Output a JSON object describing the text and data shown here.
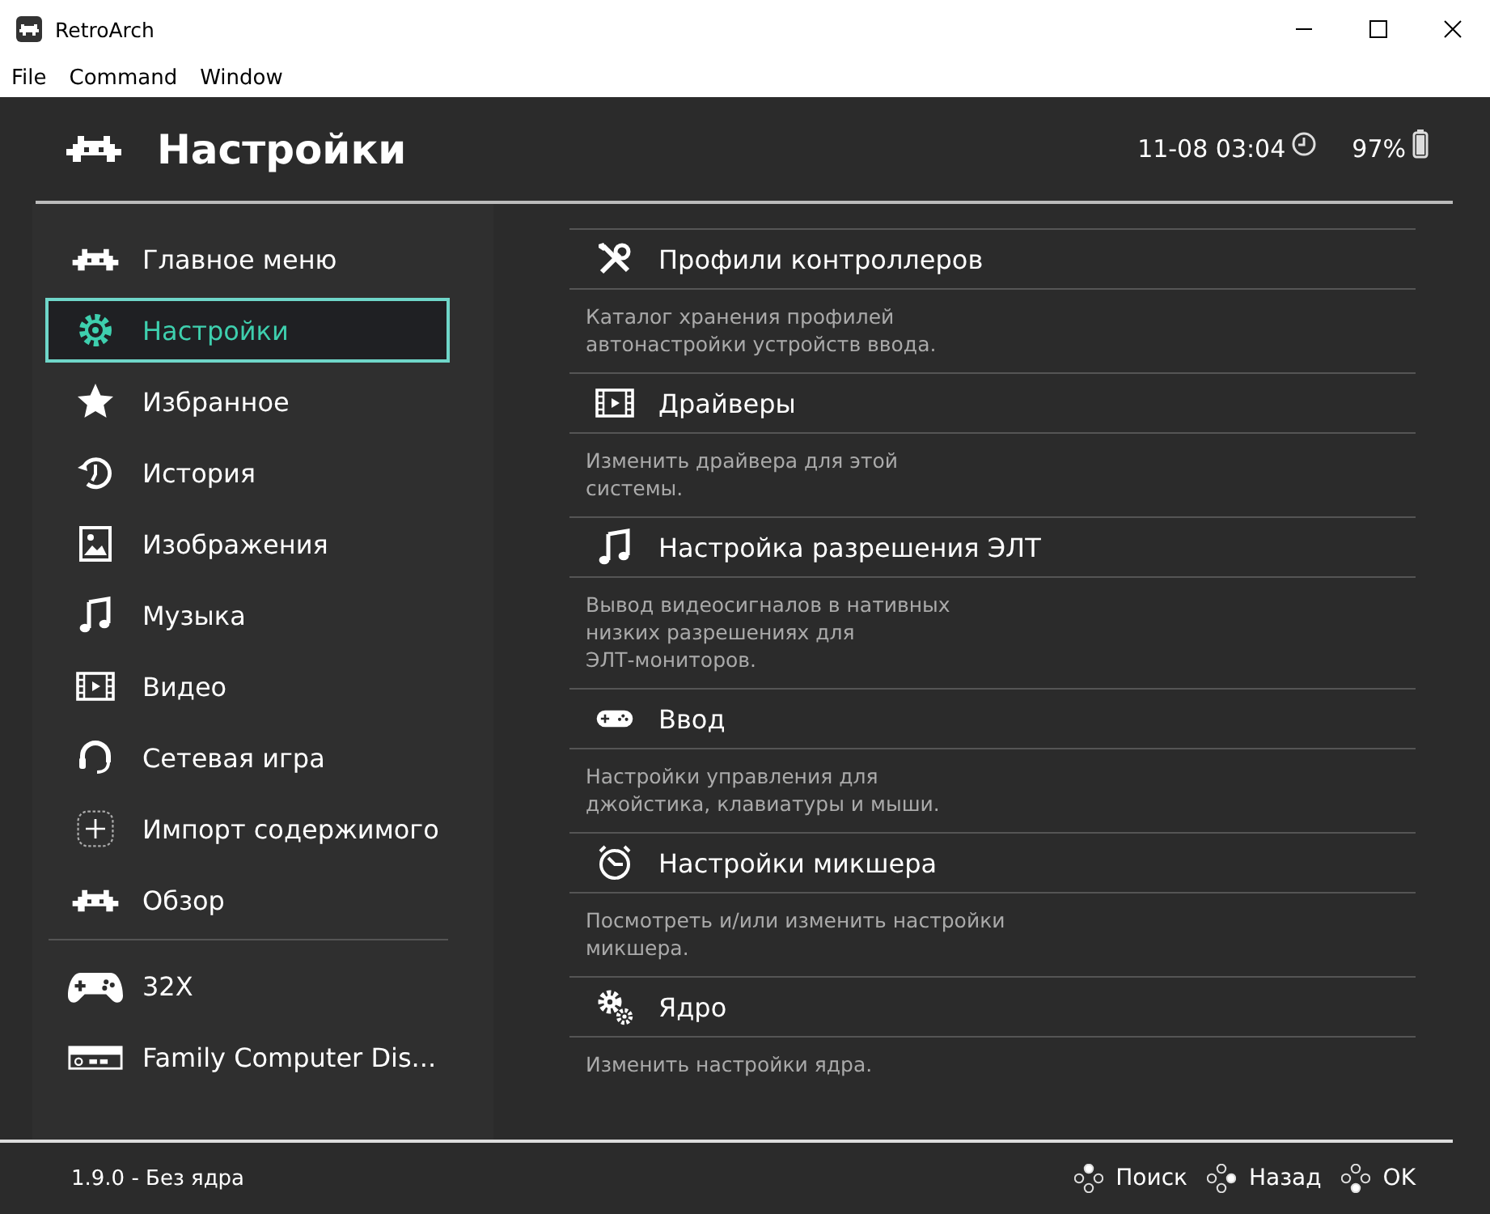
{
  "window": {
    "title": "RetroArch",
    "menu": [
      "File",
      "Command",
      "Window"
    ]
  },
  "header": {
    "title": "Настройки",
    "clock": "11-08 03:04",
    "battery": "97%"
  },
  "sidebar": {
    "items": [
      {
        "label": "Главное меню",
        "kind": "invader",
        "selected": false
      },
      {
        "label": "Настройки",
        "kind": "gear",
        "selected": true
      },
      {
        "label": "Избранное",
        "kind": "star",
        "selected": false
      },
      {
        "label": "История",
        "kind": "history",
        "selected": false
      },
      {
        "label": "Изображения",
        "kind": "image",
        "selected": false
      },
      {
        "label": "Музыка",
        "kind": "music",
        "selected": false
      },
      {
        "label": "Видео",
        "kind": "film",
        "selected": false
      },
      {
        "label": "Сетевая игра",
        "kind": "headset",
        "selected": false
      },
      {
        "label": "Импорт содержимого",
        "kind": "plus",
        "selected": false
      },
      {
        "label": "Обзор",
        "kind": "invader",
        "selected": false
      }
    ],
    "playlists": [
      {
        "label": "32X",
        "kind": "gamepad",
        "selected": false
      },
      {
        "label": "Family Computer Dis...",
        "kind": "console",
        "selected": false
      }
    ]
  },
  "settings": [
    {
      "title": "Профили контроллеров",
      "kind": "tools",
      "description": "Каталог хранения профилей\nавтонастройки устройств ввода."
    },
    {
      "title": "Драйверы",
      "kind": "film",
      "description": "Изменить драйвера для этой\nсистемы."
    },
    {
      "title": "Настройка разрешения ЭЛТ",
      "kind": "music",
      "description": "Вывод видеосигналов в нативных\nнизких разрешениях для\nЭЛТ-мониторов."
    },
    {
      "title": "Ввод",
      "kind": "controller",
      "description": "Настройки управления для\nджойстика, клавиатуры и мыши."
    },
    {
      "title": "Настройки микшера",
      "kind": "timer",
      "description": "Посмотреть и/или изменить настройки\nмикшера."
    },
    {
      "title": "Ядро",
      "kind": "gears",
      "description": "Изменить настройки ядра."
    }
  ],
  "footer": {
    "version": "1.9.0 - Без ядра",
    "hints": [
      {
        "label": "Поиск",
        "kind": "north"
      },
      {
        "label": "Назад",
        "kind": "east"
      },
      {
        "label": "OK",
        "kind": "south"
      }
    ]
  }
}
